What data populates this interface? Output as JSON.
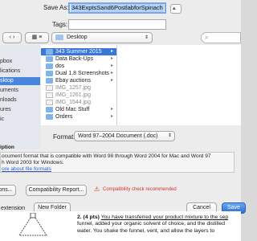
{
  "dialog": {
    "save_as_label": "Save As:",
    "save_as_value": "343ExptsSand6PostlabforSpinach",
    "tags_label": "Tags:",
    "location": "Desktop",
    "sidebar": [
      {
        "label": "pbox",
        "selected": false
      },
      {
        "label": "lications",
        "selected": false
      },
      {
        "label": "sktop",
        "selected": true
      },
      {
        "label": "uments",
        "selected": false
      },
      {
        "label": "nloads",
        "selected": false
      },
      {
        "label": "ures",
        "selected": false
      },
      {
        "label": "ic",
        "selected": false
      }
    ],
    "files": [
      {
        "name": "343 Summer 2015",
        "kind": "folder",
        "selected": true,
        "has_children": true
      },
      {
        "name": "Data Back-Ups",
        "kind": "folder",
        "selected": false,
        "has_children": true
      },
      {
        "name": "dos",
        "kind": "folder",
        "selected": false,
        "has_children": true
      },
      {
        "name": "Dual 1.8 Screenshots",
        "kind": "folder",
        "selected": false,
        "has_children": true
      },
      {
        "name": "Ebay auctions",
        "kind": "folder",
        "selected": false,
        "has_children": true
      },
      {
        "name": "IMG_1257.jpg",
        "kind": "file",
        "selected": false,
        "has_children": false
      },
      {
        "name": "IMG_1261.jpg",
        "kind": "file",
        "selected": false,
        "has_children": false
      },
      {
        "name": "IMG_1544.jpg",
        "kind": "file",
        "selected": false,
        "has_children": false
      },
      {
        "name": "Old Mac Stuff",
        "kind": "folder",
        "selected": false,
        "has_children": true
      },
      {
        "name": "Orders",
        "kind": "folder",
        "selected": false,
        "has_children": true
      }
    ],
    "format_label": "Format:",
    "format_value": "Word 97–2004 Document (.doc)",
    "description_heading": "iption",
    "description_line1": "ocument format that is compatible with Word 98 through Word 2004 for Mac and Word 97",
    "description_line2": "h Word 2003 for Windows.",
    "more_link": "ore about file formats",
    "options_button": "ons...",
    "compat_button": "Compatibility Report...",
    "compat_warning": "Compatibility check recommended",
    "hide_extension": "extension",
    "new_folder_button": "New Folder",
    "cancel_button": "Cancel",
    "save_button": "Save",
    "colors": {
      "accent": "#3876d9",
      "warning": "#d9302b",
      "sheet": "#ececec"
    }
  },
  "document": {
    "question_number": "2. (4 pts)",
    "line1": "You have transferred your product mixture to the sep",
    "line2": "funnel, added your organic solvent of choice, and the distilled",
    "line3": "water. You shake the funnel, vent, and allow the layers to"
  }
}
